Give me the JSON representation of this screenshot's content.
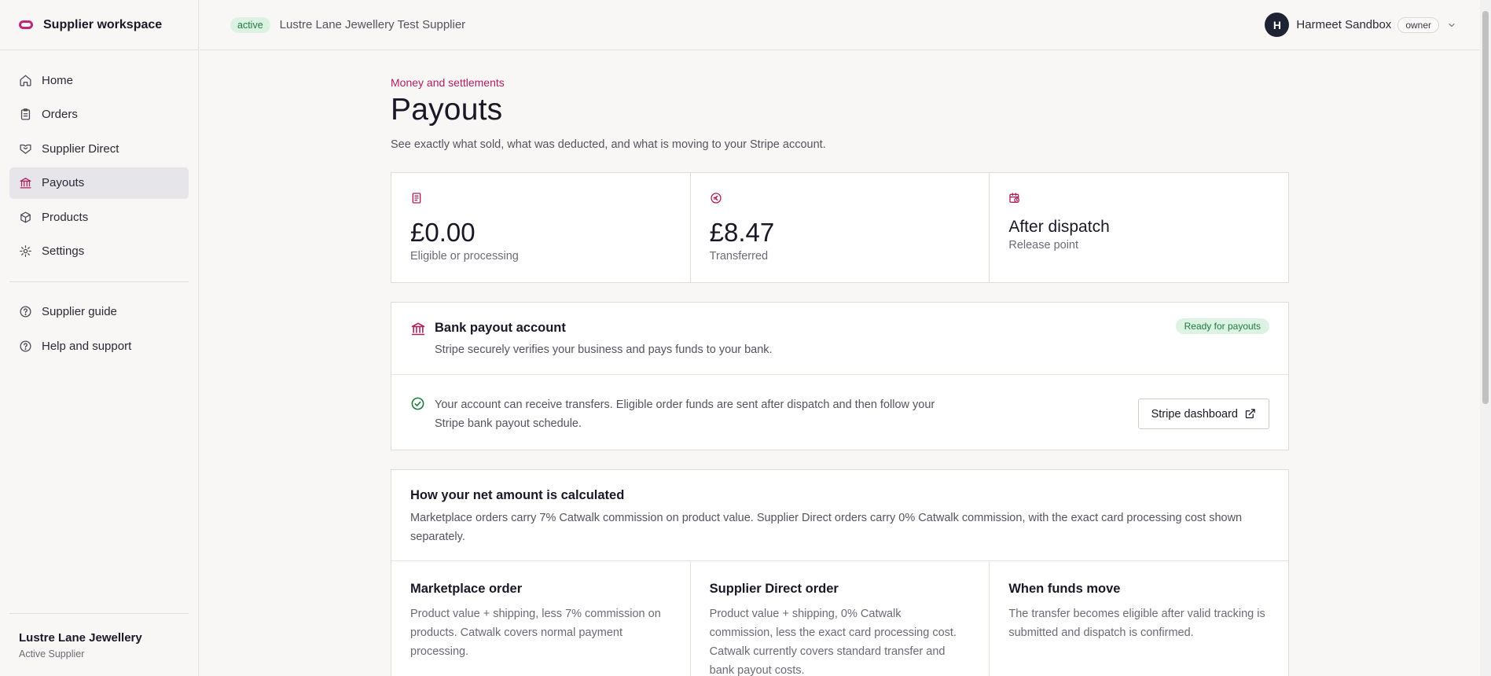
{
  "brand": {
    "title": "Supplier workspace"
  },
  "nav": {
    "items": [
      {
        "label": "Home",
        "icon": "home-icon"
      },
      {
        "label": "Orders",
        "icon": "clipboard-icon"
      },
      {
        "label": "Supplier Direct",
        "icon": "handshake-icon"
      },
      {
        "label": "Payouts",
        "icon": "bank-icon",
        "active": true
      },
      {
        "label": "Products",
        "icon": "box-icon"
      },
      {
        "label": "Settings",
        "icon": "gear-icon"
      }
    ],
    "secondary": [
      {
        "label": "Supplier guide",
        "icon": "help-circle-icon"
      },
      {
        "label": "Help and support",
        "icon": "help-circle-icon"
      }
    ]
  },
  "sidebar_footer": {
    "name": "Lustre Lane Jewellery",
    "role": "Active Supplier"
  },
  "topbar": {
    "status": "active",
    "supplier": "Lustre Lane Jewellery Test Supplier",
    "avatar_initial": "H",
    "user": "Harmeet Sandbox",
    "role": "owner"
  },
  "page": {
    "eyebrow": "Money and settlements",
    "title": "Payouts",
    "subtitle": "See exactly what sold, what was deducted, and what is moving to your Stripe account."
  },
  "stats": [
    {
      "value": "£0.00",
      "label": "Eligible or processing",
      "icon": "document-icon"
    },
    {
      "value": "£8.47",
      "label": "Transferred",
      "icon": "currency-icon"
    },
    {
      "value": "After dispatch",
      "label": "Release point",
      "icon": "calendar-clock-icon"
    }
  ],
  "bank": {
    "title": "Bank payout account",
    "desc": "Stripe securely verifies your business and pays funds to your bank.",
    "badge": "Ready for payouts",
    "message_line1": "Your account can receive transfers. Eligible order funds are sent after dispatch and then follow your",
    "message_line2": "Stripe bank payout schedule.",
    "button": "Stripe dashboard"
  },
  "calc": {
    "title": "How your net amount is calculated",
    "desc_line1": "Marketplace orders carry 7% Catwalk commission on product value. Supplier Direct orders carry 0% Catwalk commission, with the exact card processing cost shown",
    "desc_line2": "separately.",
    "cols": [
      {
        "title": "Marketplace order",
        "l1": "Product value + shipping, less 7% commission on",
        "l2": "products. Catwalk covers normal payment",
        "l3": "processing.",
        "l4": ""
      },
      {
        "title": "Supplier Direct order",
        "l1": "Product value + shipping, 0% Catwalk",
        "l2": "commission, less the exact card processing cost.",
        "l3": "Catwalk currently covers standard transfer and",
        "l4": "bank payout costs."
      },
      {
        "title": "When funds move",
        "l1": "The transfer becomes eligible after valid tracking is",
        "l2": "submitted and dispatch is confirmed.",
        "l3": "",
        "l4": ""
      }
    ]
  },
  "colors": {
    "accent": "#b0205f",
    "success_bg": "#dcf3e3",
    "success_text": "#1d7a3e"
  }
}
